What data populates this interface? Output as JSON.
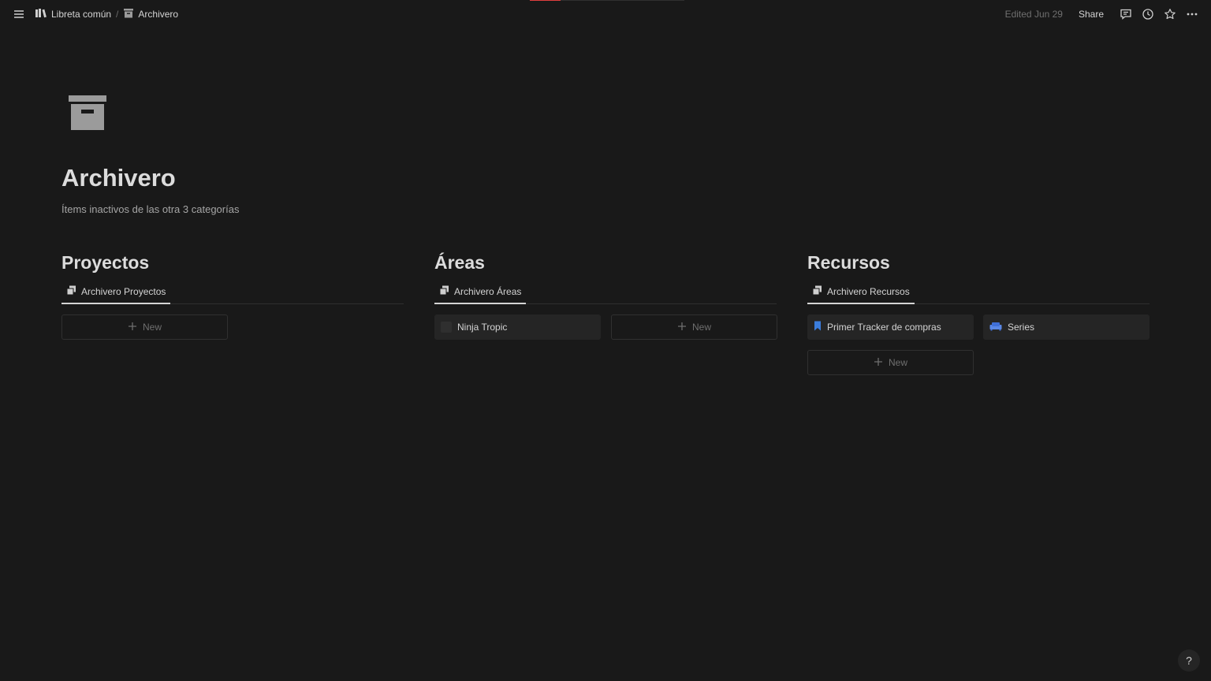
{
  "loading_progress": 0.2,
  "topbar": {
    "breadcrumb": [
      {
        "label": "Libreta común",
        "icon": "book-icon"
      },
      {
        "label": "Archivero",
        "icon": "archive-box-icon"
      }
    ],
    "separator": "/",
    "edited": "Edited Jun 29",
    "share_label": "Share"
  },
  "page": {
    "icon": "archive-box-icon",
    "title": "Archivero",
    "description": "Ítems inactivos de las otra 3 categorías"
  },
  "columns": [
    {
      "heading": "Proyectos",
      "tab_label": "Archivero Proyectos",
      "cards": [],
      "new_label": "New"
    },
    {
      "heading": "Áreas",
      "tab_label": "Archivero Áreas",
      "cards": [
        {
          "label": "Ninja Tropic",
          "icon": "checkbox-icon"
        }
      ],
      "new_label": "New"
    },
    {
      "heading": "Recursos",
      "tab_label": "Archivero Recursos",
      "cards": [
        {
          "label": "Primer Tracker de compras",
          "icon": "bookmark-icon"
        },
        {
          "label": "Series",
          "icon": "sofa-icon"
        }
      ],
      "new_label": "New"
    }
  ],
  "help_label": "?",
  "colors": {
    "background": "#191919",
    "card": "#252525",
    "bookmark": "#3b7ddd",
    "sofa": "#3f6fd8",
    "loading": "#e03e3e"
  }
}
